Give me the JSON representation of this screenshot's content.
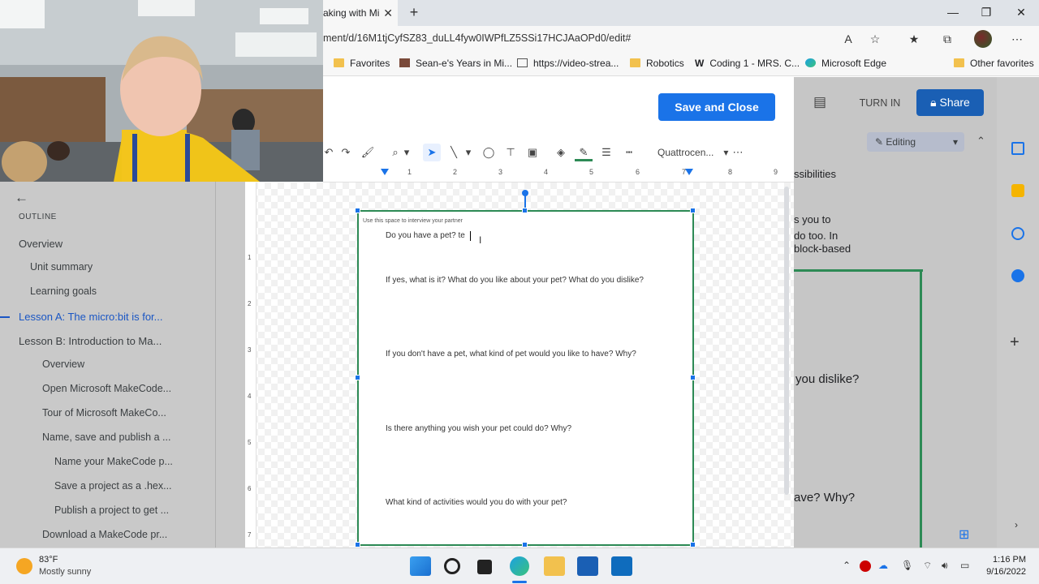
{
  "browser": {
    "tab_title": "aking with Mi",
    "url": "ment/d/16M1tjCyfSZ83_duLL4fyw0IWPfLZ5SSi17HCJAaOPd0/edit#",
    "favorites": [
      {
        "label": "Favorites"
      },
      {
        "label": "Sean-e's Years in Mi..."
      },
      {
        "label": "https://video-strea..."
      },
      {
        "label": "Robotics"
      },
      {
        "label": "Coding 1 - MRS. C..."
      },
      {
        "label": "Microsoft Edge"
      },
      {
        "label": "Other favorites"
      }
    ]
  },
  "docs": {
    "turn_in": "TURN IN",
    "share": "Share",
    "editing": "Editing",
    "right_snippets": [
      "ssibilities",
      "s you to",
      "do too. In",
      "block-based",
      "you dislike?",
      "ave? Why?"
    ]
  },
  "outline": {
    "heading": "OUTLINE",
    "items": [
      {
        "label": "Overview"
      },
      {
        "label": "Unit summary"
      },
      {
        "label": "Learning goals"
      },
      {
        "label": "Lesson A: The micro:bit is for..."
      },
      {
        "label": "Lesson B: Introduction to Ma..."
      },
      {
        "label": "Overview"
      },
      {
        "label": "Open Microsoft MakeCode..."
      },
      {
        "label": "Tour of Microsoft MakeCo..."
      },
      {
        "label": "Name, save and publish a ..."
      },
      {
        "label": "Name your MakeCode p..."
      },
      {
        "label": "Save a project as a .hex..."
      },
      {
        "label": "Publish a project to get ..."
      },
      {
        "label": "Download a MakeCode pr..."
      }
    ]
  },
  "drawing": {
    "save_close": "Save and Close",
    "font": "Quattrocen...",
    "ruler_numbers": [
      "1",
      "2",
      "3",
      "4",
      "5",
      "6",
      "7",
      "8",
      "9"
    ],
    "vruler_numbers": [
      "1",
      "2",
      "3",
      "4",
      "5",
      "6",
      "7"
    ],
    "header_note": "Use this space to interview your partner",
    "questions": [
      "Do you have a pet? te",
      "If yes, what is it? What do you like about your pet? What do you dislike?",
      "If you don't have a pet, what kind of pet would you like to have? Why?",
      "Is there anything you wish your pet could do? Why?",
      "What kind of activities would you do with your pet?"
    ]
  },
  "taskbar": {
    "weather_temp": "83°F",
    "weather_desc": "Mostly sunny",
    "time": "1:16 PM",
    "date": "9/16/2022"
  },
  "colors": {
    "accent": "#1a73e8",
    "textbox_border": "#2d8a55",
    "share": "#1a5fb4"
  }
}
